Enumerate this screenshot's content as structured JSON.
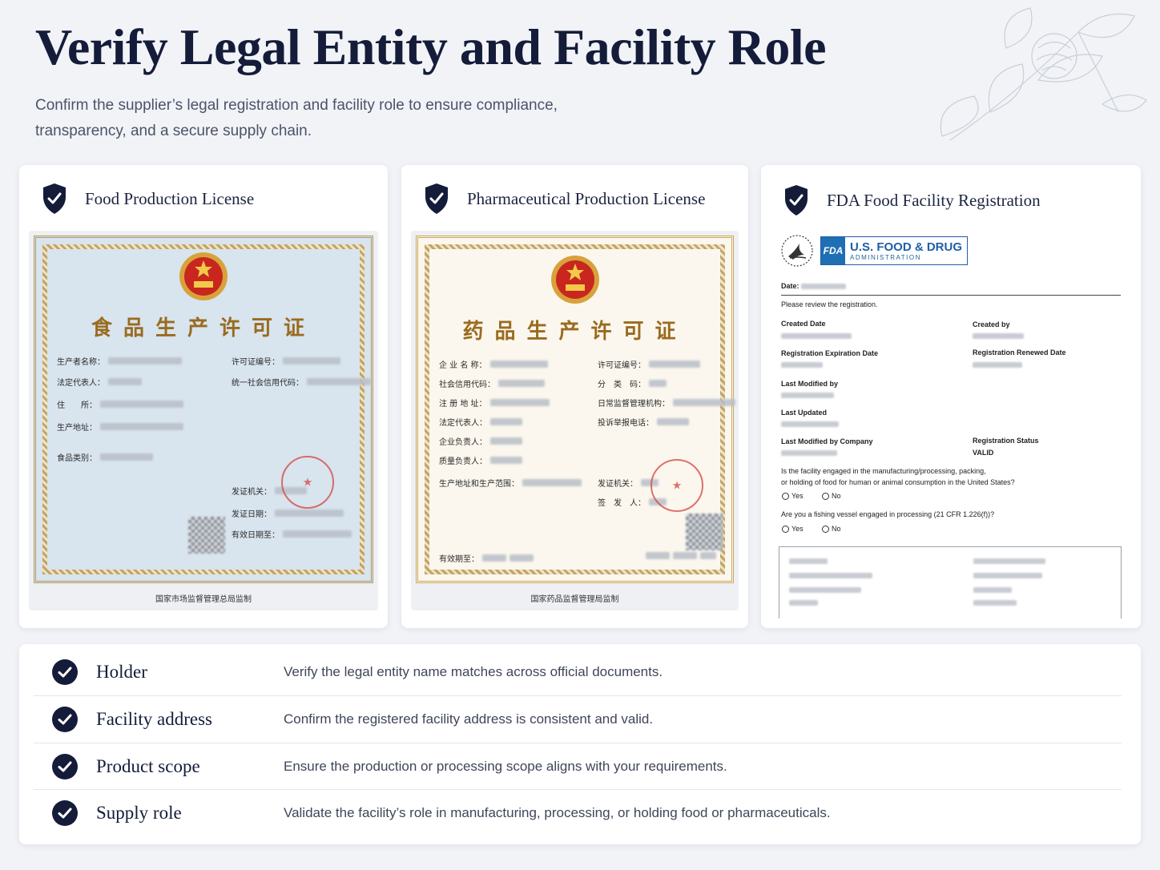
{
  "header": {
    "title": "Verify Legal Entity and Facility Role",
    "subtitle_line1": "Confirm the supplier’s legal registration and facility role to ensure compliance,",
    "subtitle_line2": "transparency, and a secure supply chain."
  },
  "colors": {
    "navy": "#141c3a",
    "gold": "#9a6b1f",
    "seal_red": "#d4453f",
    "fda_blue": "#1f5fa8"
  },
  "cards": [
    {
      "title": "Food Production License",
      "icon": "shield-check-icon",
      "document": {
        "heading": "食品生产许可证",
        "fields_left": [
          "生产者名称：",
          "法定代表人：",
          "住　　所：",
          "生产地址：",
          "食品类别："
        ],
        "fields_right": [
          "许可证编号：",
          "统一社会信用代码："
        ],
        "issue_fields": [
          "发证机关：",
          "发证日期：",
          "有效日期至："
        ],
        "issuer": "国家市场监督管理总局监制"
      }
    },
    {
      "title": "Pharmaceutical Production License",
      "icon": "shield-check-icon",
      "document": {
        "heading": "药品生产许可证",
        "fields_left": [
          "企 业 名 称：",
          "社会信用代码：",
          "注 册 地 址：",
          "法定代表人：",
          "企业负责人：",
          "质量负责人：",
          "生产地址和生产范围："
        ],
        "fields_right": [
          "许可证编号：",
          "分　类　码：",
          "日常监督管理机构：",
          "投诉举报电话：",
          "发证机关：",
          "签　发　人："
        ],
        "valid_label": "有效期至：",
        "issuer": "国家药品监督管理局监制"
      }
    },
    {
      "title": "FDA Food Facility Registration",
      "icon": "shield-check-icon",
      "document": {
        "logo_main": "U.S. FOOD & DRUG",
        "logo_sub": "ADMINISTRATION",
        "logo_mark": "FDA",
        "date_label": "Date:",
        "review_note": "Please review the registration.",
        "created_date": "Created Date",
        "created_by": "Created by",
        "expiration": "Registration Expiration Date",
        "renewed": "Registration Renewed Date",
        "last_modified_by": "Last Modified by",
        "last_updated": "Last Updated",
        "last_modified_company": "Last Modified by Company",
        "status_label": "Registration Status",
        "status_value": "VALID",
        "q1_line1": "Is the facility engaged in the manufacturing/processing, packing,",
        "q1_line2": "or holding of food for human or animal consumption in the United States?",
        "q2": "Are you a fishing vessel engaged in processing (21 CFR 1.226(f))?",
        "yes": "Yes",
        "no": "No"
      }
    }
  ],
  "checklist": [
    {
      "label": "Holder",
      "description": "Verify the legal entity name matches across official documents."
    },
    {
      "label": "Facility address",
      "description": "Confirm the registered facility address is consistent and valid."
    },
    {
      "label": "Product scope",
      "description": "Ensure the production or processing scope aligns with your requirements."
    },
    {
      "label": "Supply role",
      "description": "Validate the facility’s role in manufacturing, processing, or holding food or pharmaceuticals."
    }
  ]
}
